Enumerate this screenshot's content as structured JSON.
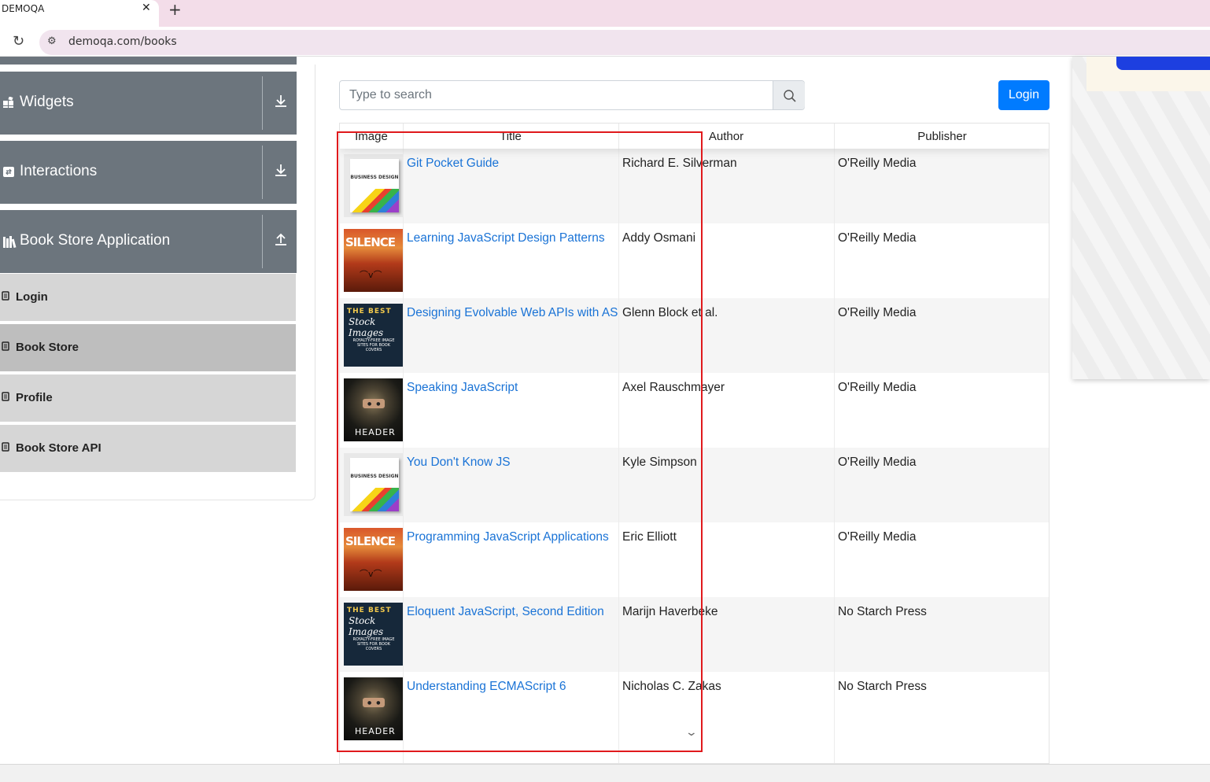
{
  "browser": {
    "tab_title": "DEMOQA",
    "tab_close": "✕",
    "new_tab": "+",
    "url": "demoqa.com/books"
  },
  "sidebar": {
    "groups": [
      {
        "label": "Widgets",
        "icon": "widgets-icon",
        "arrow": "download-arrow-icon"
      },
      {
        "label": "Interactions",
        "icon": "interactions-icon",
        "arrow": "download-arrow-icon"
      },
      {
        "label": "Book Store Application",
        "icon": "book-store-icon",
        "arrow": "upload-arrow-icon"
      }
    ],
    "items": [
      {
        "label": "Login",
        "active": false
      },
      {
        "label": "Book Store",
        "active": true
      },
      {
        "label": "Profile",
        "active": false
      },
      {
        "label": "Book Store API",
        "active": false
      }
    ]
  },
  "search": {
    "placeholder": "Type to search"
  },
  "login_label": "Login",
  "table": {
    "headers": [
      "Image",
      "Title",
      "Author",
      "Publisher"
    ],
    "rows": [
      {
        "cover": "business-design",
        "title": "Git Pocket Guide",
        "author": "Richard E. Silverman",
        "publisher": "O'Reilly Media"
      },
      {
        "cover": "silence",
        "title": "Learning JavaScript Design Patterns",
        "author": "Addy Osmani",
        "publisher": "O'Reilly Media"
      },
      {
        "cover": "best-stock-images",
        "title": "Designing Evolvable Web APIs with ASP.NET",
        "author": "Glenn Block et al.",
        "publisher": "O'Reilly Media"
      },
      {
        "cover": "header",
        "title": "Speaking JavaScript",
        "author": "Axel Rauschmayer",
        "publisher": "O'Reilly Media"
      },
      {
        "cover": "business-design",
        "title": "You Don't Know JS",
        "author": "Kyle Simpson",
        "publisher": "O'Reilly Media"
      },
      {
        "cover": "silence",
        "title": "Programming JavaScript Applications",
        "author": "Eric Elliott",
        "publisher": "O'Reilly Media"
      },
      {
        "cover": "best-stock-images",
        "title": "Eloquent JavaScript, Second Edition",
        "author": "Marijn Haverbeke",
        "publisher": "No Starch Press"
      },
      {
        "cover": "header",
        "title": "Understanding ECMAScript 6",
        "author": "Nicholas C. Zakas",
        "publisher": "No Starch Press"
      }
    ]
  },
  "cover_text": {
    "business": "BUSINESS DESIGN",
    "silence": "SILENCE",
    "best1": "THE BEST",
    "best2": "Stock Images",
    "best3": "ROYALTY-FREE IMAGE SITES FOR BOOK COVERS",
    "header": "HEADER"
  },
  "colors": {
    "accent": "#007bff",
    "link": "#1a73d6",
    "sidebar_group": "#6c757d",
    "highlight": "#e0191c"
  }
}
